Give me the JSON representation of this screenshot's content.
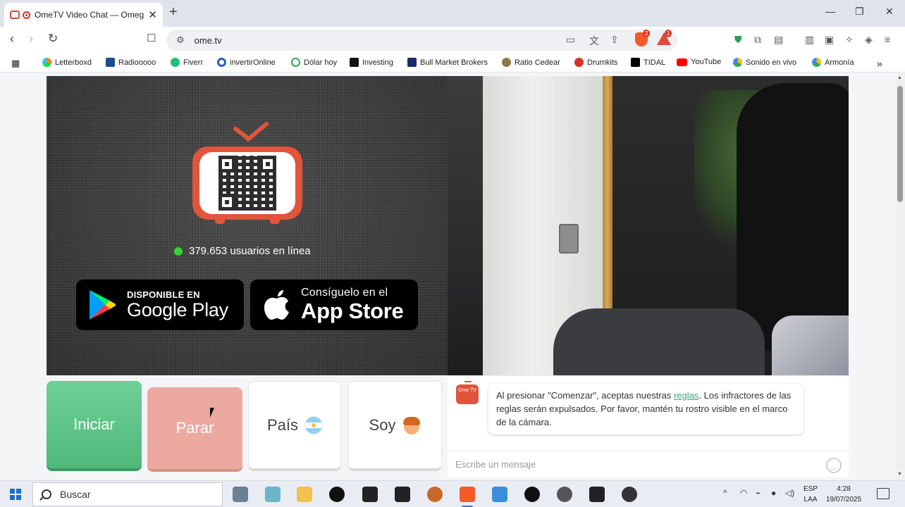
{
  "browser": {
    "tab_title": "OmeTV Video Chat — Omeg",
    "url": "ome.tv",
    "shield_badge": "2",
    "rewards_badge": "1"
  },
  "bookmarks": [
    {
      "label": "Letterboxd",
      "color": "#40bcf4"
    },
    {
      "label": "Radiooooo",
      "color": "#1a4d8f"
    },
    {
      "label": "Fiverr",
      "color": "#1dbf73"
    },
    {
      "label": "invertirOnline",
      "color": "#2b5fb4"
    },
    {
      "label": "Dólar hoy",
      "color": "#33a852"
    },
    {
      "label": "Investing",
      "color": "#111111"
    },
    {
      "label": "Bull Market Brokers",
      "color": "#1a2a6c"
    },
    {
      "label": "Ratio  Cedear",
      "color": "#8a7a4a"
    },
    {
      "label": "Drumkits",
      "color": "#d8302e"
    },
    {
      "label": "TIDAL",
      "color": "#000000"
    },
    {
      "label": "YouTube",
      "color": "#ff0000"
    },
    {
      "label": "Sonido en vivo",
      "color": "#1fa463"
    },
    {
      "label": "Armonía",
      "color": "#1fa463"
    }
  ],
  "left_panel": {
    "online_count": "379.653 usuarios en línea",
    "google_play": {
      "small": "DISPONIBLE EN",
      "big": "Google Play"
    },
    "app_store": {
      "small": "Consíguelo en el",
      "big": "App Store"
    }
  },
  "controls": {
    "start": "Iniciar",
    "stop": "Parar",
    "country": "País",
    "gender": "Soy"
  },
  "chat": {
    "logo_text": "Ome TV",
    "message_before_link": "Al presionar \"Comenzar\", aceptas nuestras ",
    "message_link": "reglas",
    "message_after_link": ". Los infractores de las reglas serán expulsados. Por favor, mantén tu rostro visible en el marco de la cámara.",
    "input_placeholder": "Escribe un mensaje"
  },
  "taskbar": {
    "search_label": "Buscar",
    "lang_line1": "ESP",
    "lang_line2": "LAA",
    "time": "4:28",
    "date": "19/07/2025"
  },
  "colors": {
    "accent_green": "#5cc488",
    "stop_pink": "#eca9a0",
    "brand_red": "#e0553b"
  }
}
